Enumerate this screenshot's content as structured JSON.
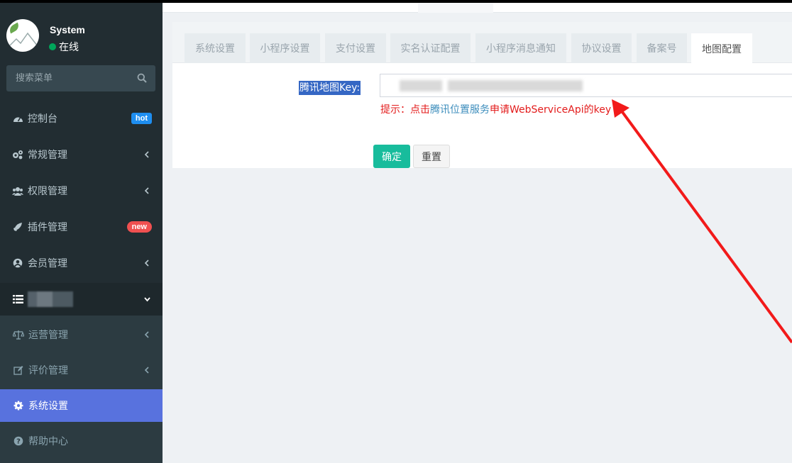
{
  "user": {
    "name": "System",
    "status": "在线",
    "status_color": "#00a65a"
  },
  "search": {
    "placeholder": "搜索菜单",
    "icon": "search-icon"
  },
  "sidebar": {
    "items": [
      {
        "label": "控制台",
        "icon": "dashboard-icon",
        "badge": "hot"
      },
      {
        "label": "常规管理",
        "icon": "cogs-icon"
      },
      {
        "label": "权限管理",
        "icon": "group-icon"
      },
      {
        "label": "插件管理",
        "icon": "rocket-icon",
        "badge": "new"
      },
      {
        "label": "会员管理",
        "icon": "user-circle-icon"
      },
      {
        "label": "",
        "icon": "list-icon",
        "expanded": true
      }
    ],
    "subitems": [
      {
        "label": "运营管理",
        "icon": "balance-scale-icon"
      },
      {
        "label": "评价管理",
        "icon": "edit-icon"
      },
      {
        "label": "系统设置",
        "icon": "gear-icon",
        "active": true
      },
      {
        "label": "帮助中心",
        "icon": "question-circle-icon"
      }
    ]
  },
  "tabs": [
    "系统设置",
    "小程序设置",
    "支付设置",
    "实名认证配置",
    "小程序消息通知",
    "协议设置",
    "备案号",
    "地图配置"
  ],
  "active_tab": "地图配置",
  "form": {
    "key_label": "腾讯地图Key:",
    "hint_prefix": "提示：点击",
    "hint_link": "腾讯位置服务",
    "hint_suffix": "申请WebServiceApi的key",
    "ok_label": "确定",
    "reset_label": "重置"
  },
  "colors": {
    "sidebar_bg": "#222d32",
    "active_menu": "#5872de",
    "ok_button": "#18bc9c",
    "hint_red": "#e31b1b",
    "link_blue": "#3c8dbc",
    "arrow_red": "#f21a1a"
  }
}
